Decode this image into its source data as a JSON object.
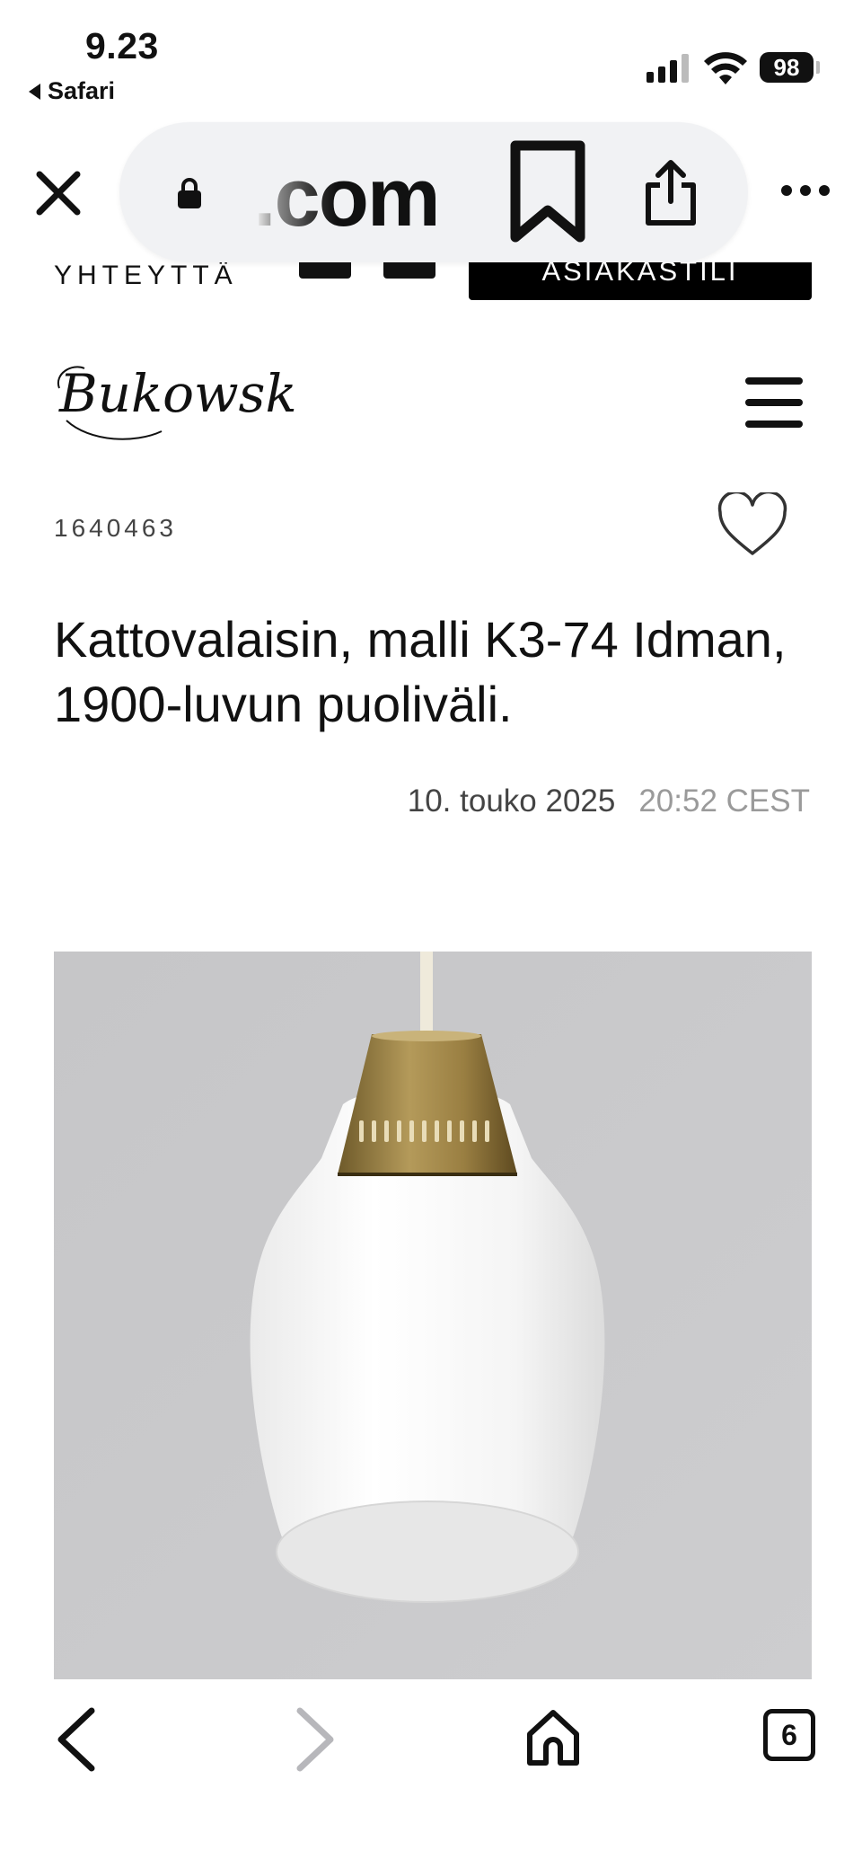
{
  "status_bar": {
    "time": "9.23",
    "back_app": "Safari",
    "battery": "98"
  },
  "browser": {
    "url_display": ".com",
    "icons": {
      "close": "close-icon",
      "lock": "lock-icon",
      "bookmark": "bookmark-icon",
      "share": "share-icon",
      "more": "more-icon"
    }
  },
  "site_header": {
    "contact_label": "YHTEYTTÄ",
    "account_label": "ASIAKASTILI",
    "logo_text": "Bukowskis"
  },
  "lot": {
    "number": "1640463",
    "title": "Kattovalaisin, malli K3-74 Idman, 1900-luvun puoliväli.",
    "date": "10. touko 2025",
    "time": "20:52 CEST"
  },
  "toolbar": {
    "tabs_count": "6",
    "icons": {
      "back": "chevron-left-icon",
      "forward": "chevron-right-icon",
      "home": "home-icon",
      "tabs": "tabs-icon"
    }
  }
}
